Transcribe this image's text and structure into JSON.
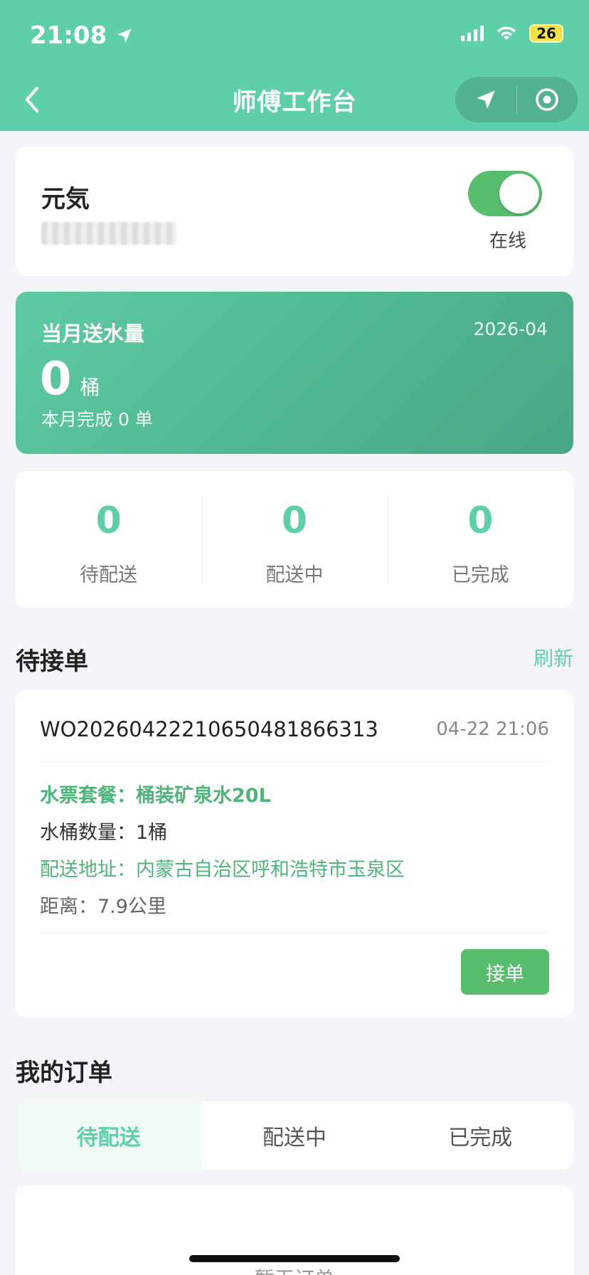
{
  "status_bar": {
    "time": "21:08",
    "battery": "26"
  },
  "header": {
    "title": "师傅工作台"
  },
  "user": {
    "name": "元気",
    "online_label": "在线",
    "online": true
  },
  "water": {
    "title": "当月送水量",
    "date": "2026-04",
    "amount": "0",
    "unit": "桶",
    "sub": "本月完成 0 单"
  },
  "stats": [
    {
      "value": "0",
      "label": "待配送"
    },
    {
      "value": "0",
      "label": "配送中"
    },
    {
      "value": "0",
      "label": "已完成"
    }
  ],
  "pending": {
    "title": "待接单",
    "refresh": "刷新",
    "order": {
      "id": "WO20260422210650481866313",
      "time": "04-22 21:06",
      "package": "水票套餐：桶装矿泉水20L",
      "quantity": "水桶数量：1桶",
      "address": "配送地址：内蒙古自治区呼和浩特市玉泉区",
      "distance": "距离：7.9公里",
      "accept_label": "接单"
    }
  },
  "my_orders": {
    "title": "我的订单",
    "tabs": [
      {
        "label": "待配送"
      },
      {
        "label": "配送中"
      },
      {
        "label": "已完成"
      }
    ],
    "empty_text": "暂无订单"
  },
  "colors": {
    "accent": "#5fcfab",
    "button_green": "#58bd6c",
    "text_green": "#4fb47a"
  }
}
